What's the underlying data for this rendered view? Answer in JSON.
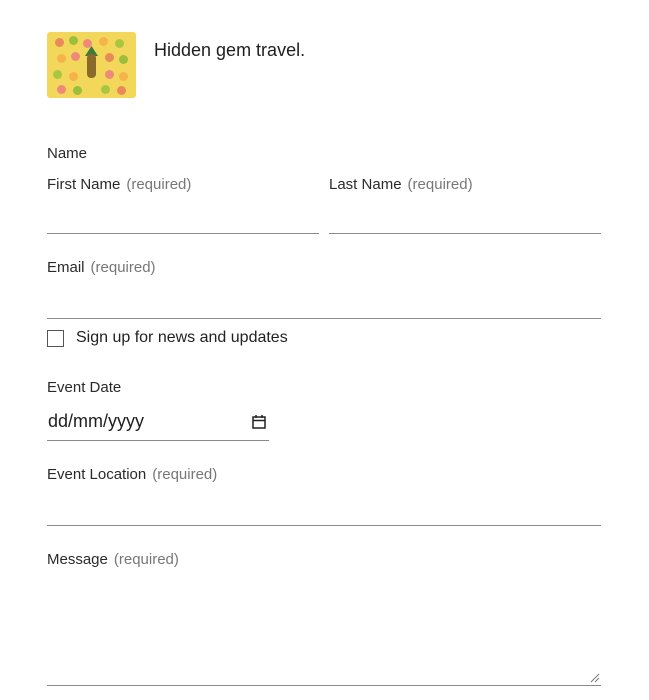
{
  "header": {
    "thumbnail_icon": "citrus-fruit-image",
    "brand_text": "Hidden gem travel."
  },
  "form": {
    "name_group_label": "Name",
    "required_text": "(required)",
    "first_name": {
      "label": "First Name",
      "value": ""
    },
    "last_name": {
      "label": "Last Name",
      "value": ""
    },
    "email": {
      "label": "Email",
      "value": ""
    },
    "newsletter": {
      "label": "Sign up for news and updates",
      "checked": false
    },
    "event_date": {
      "label": "Event Date",
      "value": "dd/mm/yyyy",
      "icon": "calendar-icon"
    },
    "event_location": {
      "label": "Event Location",
      "value": ""
    },
    "message": {
      "label": "Message",
      "value": ""
    }
  },
  "colors": {
    "thumbnail_bg": "#f2d75a",
    "underline": "#8a8a8a",
    "required_text": "#777777"
  }
}
